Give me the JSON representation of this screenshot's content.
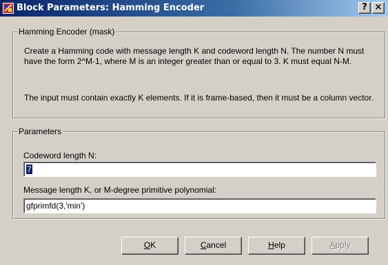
{
  "window": {
    "title": "Block Parameters: Hamming Encoder",
    "help_glyph": "?",
    "close_glyph": "×"
  },
  "mask": {
    "group_title": "Hamming Encoder (mask)",
    "description_1": "Create a Hamming code with message length K and codeword length N.  The number N must have the form 2^M-1, where M is an integer greater than or equal to 3.  K must equal N-M.",
    "description_2": "The input must contain exactly K elements.  If it is frame-based, then it must be a column vector."
  },
  "parameters": {
    "group_title": "Parameters",
    "codeword_label": "Codeword length N:",
    "codeword_value": "7",
    "message_label": "Message length K, or M-degree primitive polynomial:",
    "message_value": "gfprimfd(3,'min')"
  },
  "buttons": {
    "ok_mnemonic": "O",
    "ok_rest": "K",
    "cancel_mnemonic": "C",
    "cancel_rest": "ancel",
    "help_mnemonic": "H",
    "help_rest": "elp",
    "apply_mnemonic": "A",
    "apply_rest": "pply"
  }
}
